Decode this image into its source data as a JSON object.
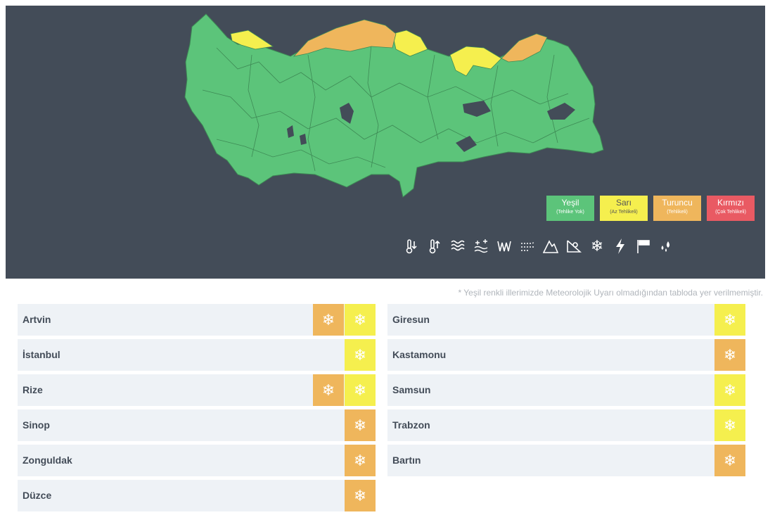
{
  "legend": [
    {
      "name": "Yeşil",
      "desc": "(Tehlike Yok)",
      "bg": "#5cc47a",
      "fg": "#ffffff"
    },
    {
      "name": "Sarı",
      "desc": "(Az Tehlikeli)",
      "bg": "#f5ef4e",
      "fg": "#555555"
    },
    {
      "name": "Turuncu",
      "desc": "(Tehlikeli)",
      "bg": "#efb65c",
      "fg": "#ffffff"
    },
    {
      "name": "Kırmızı",
      "desc": "(Çok Tehlikeli)",
      "bg": "#e95a63",
      "fg": "#ffffff"
    }
  ],
  "hazards": [
    "cold-icon",
    "hot-icon",
    "fog-icon",
    "snow-melt-icon",
    "ice-icon",
    "sandstorm-icon",
    "avalanche-icon",
    "landslide-icon",
    "snow-icon",
    "thunder-icon",
    "wind-icon",
    "rain-icon"
  ],
  "note": "* Yeşil renkli illerimizde Meteorolojik Uyarı olmadığından tabloda yer verilmemiştir.",
  "colors": {
    "yellow": "#f5ef4e",
    "orange": "#efb65c",
    "green": "#5cc47a",
    "panel": "#434c58"
  },
  "left_table": [
    {
      "city": "Artvin",
      "levels": [
        "orange",
        "yellow"
      ]
    },
    {
      "city": "İstanbul",
      "levels": [
        "yellow"
      ]
    },
    {
      "city": "Rize",
      "levels": [
        "orange",
        "yellow"
      ]
    },
    {
      "city": "Sinop",
      "levels": [
        "orange"
      ]
    },
    {
      "city": "Zonguldak",
      "levels": [
        "orange"
      ]
    },
    {
      "city": "Düzce",
      "levels": [
        "orange"
      ]
    }
  ],
  "right_table": [
    {
      "city": "Giresun",
      "levels": [
        "yellow"
      ]
    },
    {
      "city": "Kastamonu",
      "levels": [
        "orange"
      ]
    },
    {
      "city": "Samsun",
      "levels": [
        "yellow"
      ]
    },
    {
      "city": "Trabzon",
      "levels": [
        "yellow"
      ]
    },
    {
      "city": "Bartın",
      "levels": [
        "orange"
      ]
    }
  ]
}
